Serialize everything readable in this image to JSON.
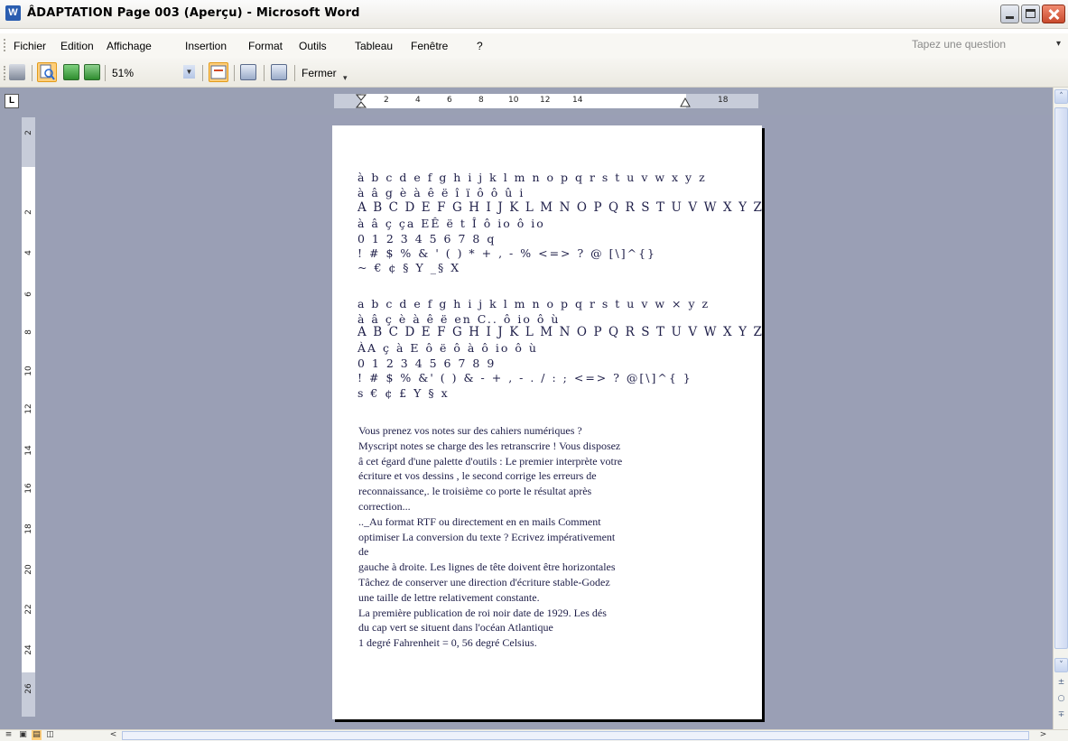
{
  "window": {
    "title": "ÂDAPTATION Page 003 (Aperçu) - Microsoft Word",
    "app_icon_letter": "W"
  },
  "menu": {
    "items": [
      "Fichier",
      "Edition",
      "Affichage",
      "Insertion",
      "Format",
      "Outils",
      "Tableau",
      "Fenêtre",
      "?"
    ],
    "question_placeholder": "Tapez une question"
  },
  "toolbar": {
    "zoom_value": "51%",
    "close_label": "Fermer",
    "icons": [
      "print-icon",
      "magnifier-icon",
      "one-page-icon",
      "multiple-pages-icon",
      "view-ruler-icon",
      "shrink-to-fit-icon",
      "full-screen-icon"
    ]
  },
  "ruler": {
    "toggle_label": "L",
    "h_ticks": [
      "2",
      "4",
      "6",
      "8",
      "10",
      "12",
      "14",
      "18"
    ],
    "v_ticks": [
      "2",
      "2",
      "4",
      "6",
      "8",
      "10",
      "12",
      "14",
      "16",
      "18",
      "20",
      "22",
      "24",
      "26"
    ]
  },
  "document": {
    "block1": [
      "à b c d e f g h i j k l m n o p q r s t u v w x y z",
      "à â g è à ê ë î ï ô ô û i",
      "A B C D E F G H I J K L M N O P Q R S T U V W X Y Z",
      "à â ç ça EÊ ë t Î ô io ô io",
      "0 1 2 3 4 5 6 7 8 q",
      "! # $ % & ' ( ) * + , - % <=> ? @ [\\]^{}",
      "~ € ¢ § Y _§ X"
    ],
    "block2": [
      "a b c d e f g h i j k l m n o p q r s t u v w × y z",
      "à â ç è à ê ë en C.. ô io ô ù",
      "A B C D E F G H I J K L M N O P Q R S T U V W X Y Z",
      "ÀA ç à E ô ë ô à ô io ô ù",
      "0 1 2 3 4 5 6 7 8 9",
      "! # $ % &' ( ) & - + , - . / : ; <=> ? @[\\]^{ }",
      "s € ¢ £ Y § x"
    ],
    "paragraph": [
      "Vous prenez vos notes sur des cahiers numériques ?",
      "Myscript notes se charge des les retranscrire ! Vous disposez",
      "â cet égard d'une palette d'outils : Le premier interprète votre",
      "écriture et vos dessins , le second corrige les erreurs de",
      "reconnaissance,. le troisième co porte le résultat après",
      "correction...",
      ".._Au format RTF ou directement en en mails Comment",
      "optimiser La conversion du texte ? Ecrivez impérativement",
      "de",
      "gauche à droite. Les lignes de tête doivent être horizontales",
      "Tâchez de conserver une direction d'écriture stable-Godez",
      "une taille de lettre relativement constante.",
      "La première publication de roi noir date de 1929. Les dés",
      "du cap vert se situent dans l'océan Atlantique",
      "1 degré Fahrenheit = 0, 56 degré Celsius."
    ]
  },
  "scroll": {
    "up": "˄",
    "down": "˅",
    "prev": "±",
    "select": "○",
    "next": "∓"
  },
  "bottom": {
    "view_icons": [
      "≡",
      "▣",
      "▤",
      "◫"
    ],
    "left_arrow": "<",
    "right_arrow": ">"
  },
  "colors": {
    "workspace": "#9a9fb5",
    "text": "#20204a",
    "titlebar": "#eceae4"
  }
}
